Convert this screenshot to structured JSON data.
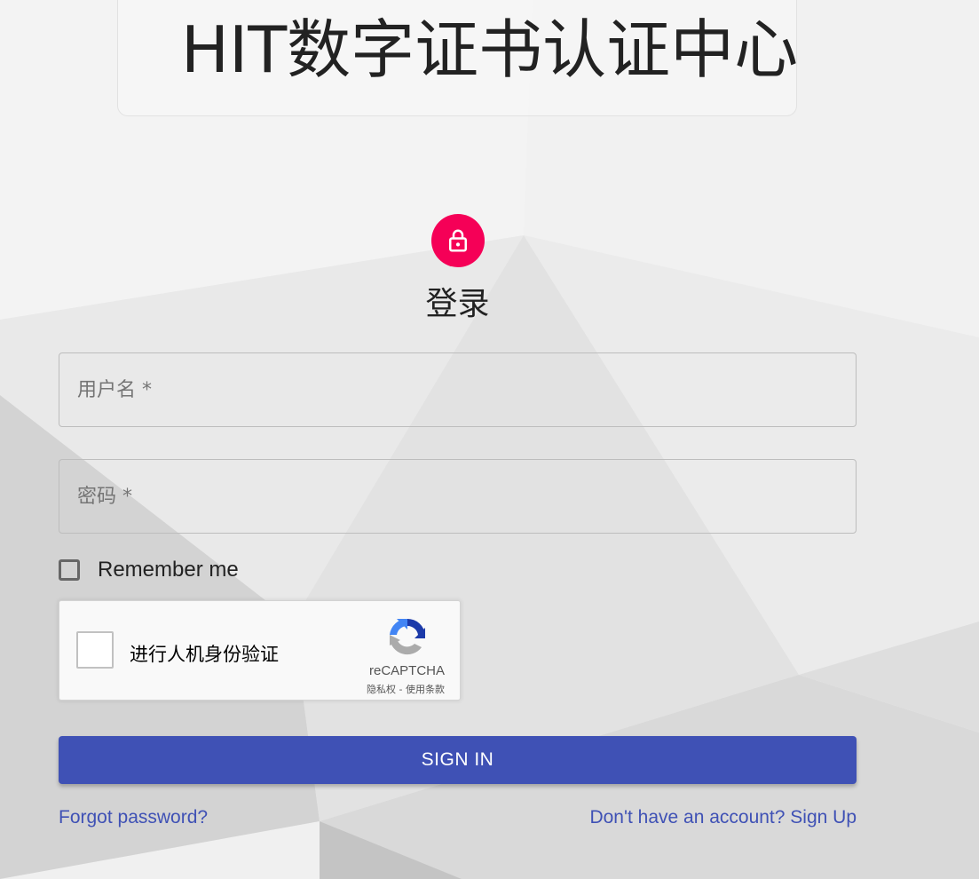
{
  "header": {
    "title": "HIT数字证书认证中心"
  },
  "login": {
    "heading": "登录",
    "accent_color": "#f50057",
    "icon": "lock-icon"
  },
  "form": {
    "username_placeholder": "用户名 *",
    "password_placeholder": "密码 *",
    "remember_label": "Remember me",
    "remember_checked": false,
    "submit_label": "SIGN IN",
    "primary_color": "#3f51b5"
  },
  "recaptcha": {
    "label": "进行人机身份验证",
    "brand": "reCAPTCHA",
    "links": "隐私权 - 使用条款",
    "checked": false
  },
  "links": {
    "forgot": "Forgot password?",
    "signup": "Don't have an account? Sign Up"
  }
}
